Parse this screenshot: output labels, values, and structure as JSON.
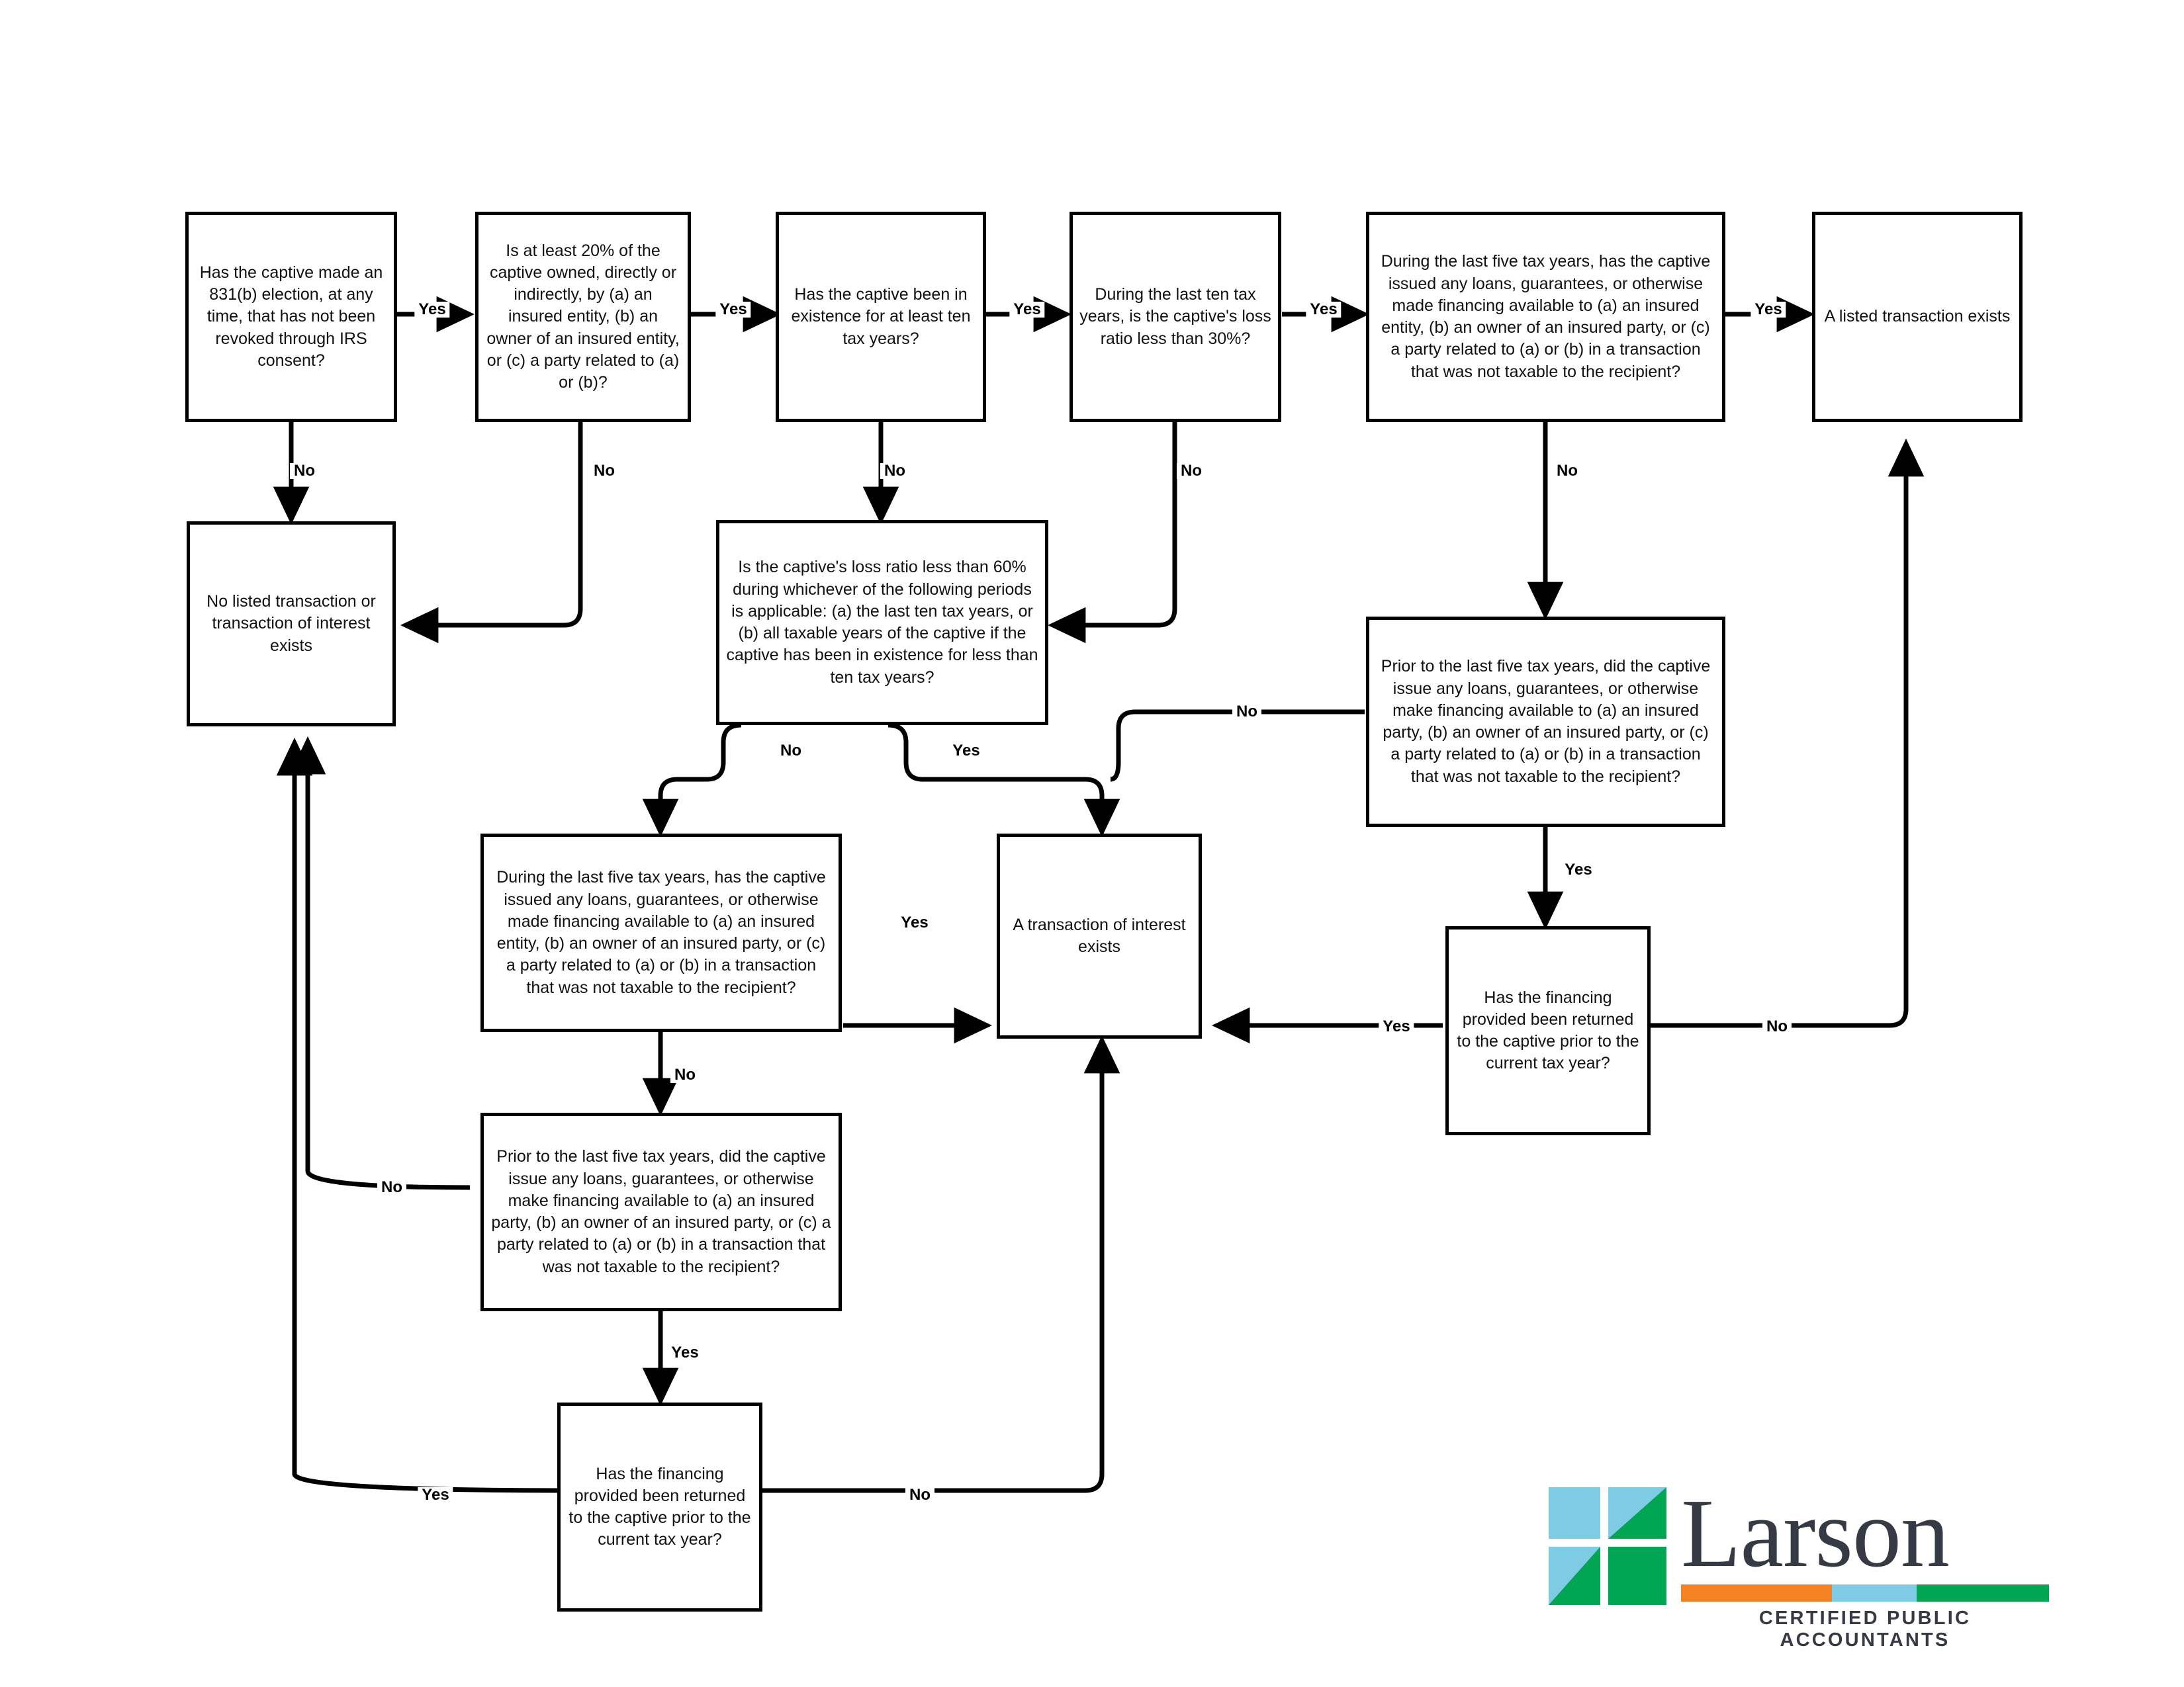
{
  "diagram": {
    "title_text": "Captive insurance listed transaction / transaction of interest decision flowchart",
    "line_color": "#000000",
    "box_border_color": "#000000",
    "box_fill": "#ffffff",
    "text_color": "#111111"
  },
  "nodes": {
    "n1_831b_election": "Has the captive made an 831(b) election, at any time, that has not been revoked through IRS consent?",
    "n2_twenty_percent": "Is at least 20% of the captive owned, directly or indirectly, by (a) an insured entity, (b) an owner of an insured entity, or (c) a party related to (a) or (b)?",
    "n3_ten_years": "Has the captive been in existence for at least ten tax years?",
    "n4_loss_ratio_30": "During the last ten tax years, is the captive's loss ratio less than 30%?",
    "n5_five_years_financing": "During the last five tax years, has the captive issued any loans, guarantees, or otherwise made financing available to (a) an insured entity, (b) an owner of an insured party, or (c) a party related to (a) or (b) in a transaction that was not taxable to the recipient?",
    "n6_listed_transaction": "A listed transaction exists",
    "n7_no_listed_transaction": "No listed transaction or  transaction of interest exists",
    "n8_loss_ratio_60": "Is the captive's loss ratio less than 60% during whichever of the following periods is applicable: (a) the last ten tax years, or (b) all taxable years of the captive if the captive has been in existence for less than ten tax years?",
    "n9_prior_five_financing_right": "Prior to the last five tax years, did the captive issue any loans, guarantees, or otherwise make financing available to (a) an insured party, (b) an owner of an insured party, or (c) a party related to (a) or (b) in a transaction that was not taxable to the recipient?",
    "n10_five_years_financing_left": "During the last five tax years, has the captive issued any loans, guarantees, or otherwise made financing available to (a) an insured entity, (b) an owner of an insured party, or (c) a party related to (a) or (b) in a transaction that was not taxable to the recipient?",
    "n11_transaction_of_interest": "A transaction of interest exists",
    "n12_financing_returned_right": "Has the financing provided been returned to the captive prior to the current tax year?",
    "n13_prior_five_financing_left": "Prior to the last five tax years, did the captive issue any loans, guarantees, or otherwise make financing available to (a) an insured party, (b) an owner of an insured party, or (c) a party related to (a) or (b) in a transaction that was not taxable to the recipient?",
    "n14_financing_returned_left": "Has the financing provided been returned to the captive prior to the current tax year?"
  },
  "edge_labels": {
    "e1_yes": "Yes",
    "e1_no": "No",
    "e2_yes": "Yes",
    "e2_no": "No",
    "e3_yes": "Yes",
    "e3_no": "No",
    "e4_yes": "Yes",
    "e4_no": "No",
    "e5_yes": "Yes",
    "e5_no": "No",
    "e8_no": "No",
    "e8_yes": "Yes",
    "e9_no": "No",
    "e9_yes": "Yes",
    "e10_yes": "Yes",
    "e10_no": "No",
    "e12_yes": "Yes",
    "e12_no": "No",
    "e13_no": "No",
    "e13_yes": "Yes",
    "e14_yes": "Yes",
    "e14_no": "No"
  },
  "logo": {
    "name": "Larson",
    "tagline": "CERTIFIED PUBLIC ACCOUNTANTS",
    "colors": {
      "light_blue": "#7ecbe4",
      "green": "#00a651",
      "orange": "#f58220",
      "dark": "#353a45"
    }
  }
}
